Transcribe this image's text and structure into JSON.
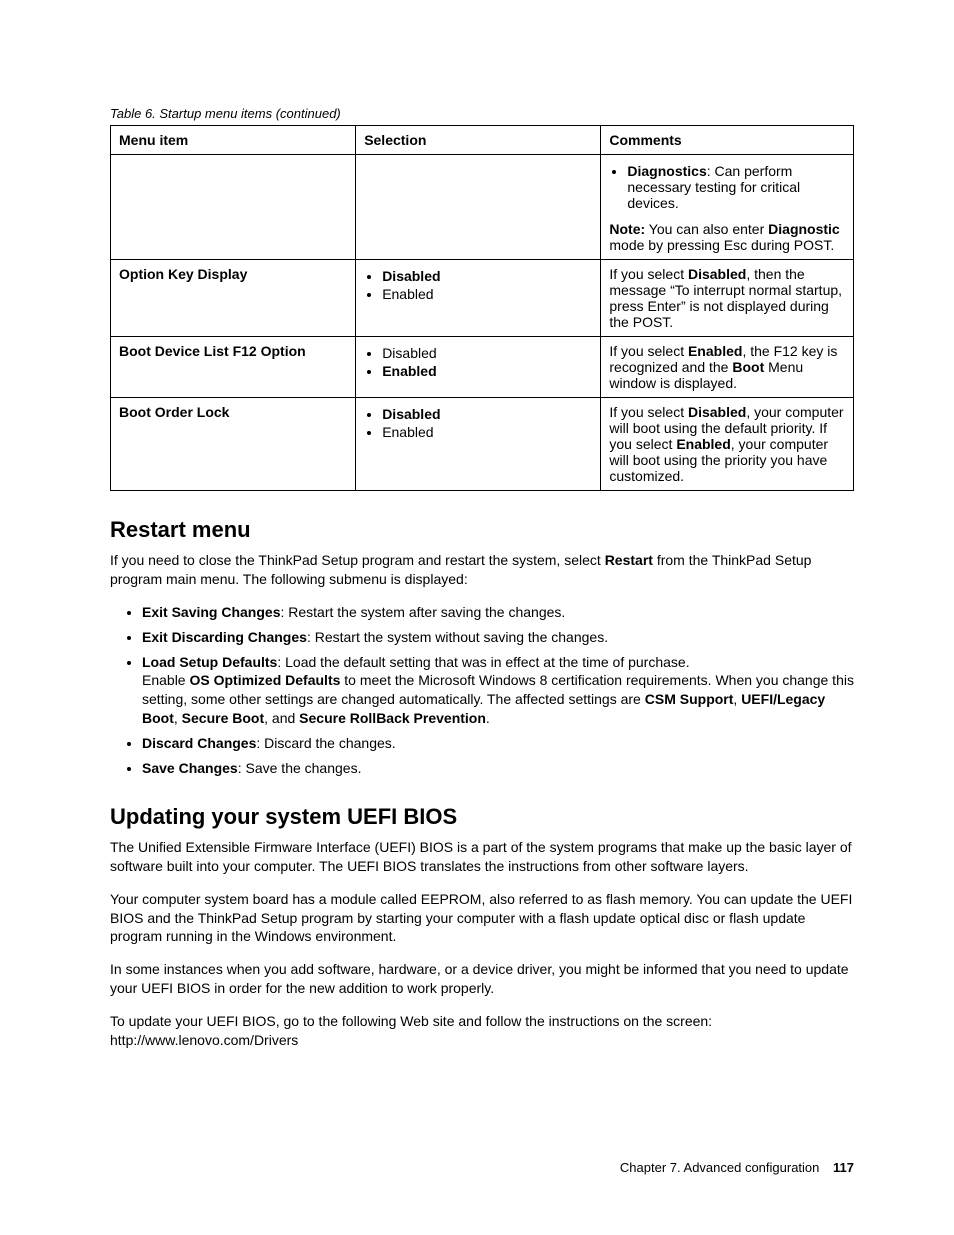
{
  "tableCaption": "Table 6.  Startup menu items (continued)",
  "headers": {
    "menu": "Menu item",
    "selection": "Selection",
    "comments": "Comments"
  },
  "row0": {
    "diagLabel": "Diagnostics",
    "diagText": ": Can perform necessary testing for critical devices.",
    "notePrefix": "Note:",
    "noteMid": " You can also enter ",
    "noteBold": "Diagnostic",
    "noteEnd": " mode by pressing Esc during POST."
  },
  "row1": {
    "menu": "Option Key Display",
    "sel1": "Disabled",
    "sel2": "Enabled",
    "c1": "If you select ",
    "cBold": "Disabled",
    "c2": ", then the message “To interrupt normal startup, press Enter” is not displayed during the POST."
  },
  "row2": {
    "menu": "Boot Device List F12 Option",
    "sel1": "Disabled",
    "sel2": "Enabled",
    "c1": "If you select ",
    "cBold1": "Enabled",
    "c2": ", the F12 key is recognized and the ",
    "cBold2": "Boot",
    "c3": " Menu window is displayed."
  },
  "row3": {
    "menu": "Boot Order Lock",
    "sel1": "Disabled",
    "sel2": "Enabled",
    "c1": "If you select ",
    "cBold1": "Disabled",
    "c2": ", your computer will boot using the default priority. If you select ",
    "cBold2": "Enabled",
    "c3": ", your computer will boot using the priority you have customized."
  },
  "restart": {
    "heading": "Restart menu",
    "intro1": "If you need to close the ThinkPad Setup program and restart the system, select ",
    "introBold": "Restart",
    "intro2": " from the ThinkPad Setup program main menu.  The following submenu is displayed:",
    "li1b": "Exit Saving Changes",
    "li1t": ": Restart the system after saving the changes.",
    "li2b": "Exit Discarding Changes",
    "li2t": ": Restart the system without saving the changes.",
    "li3b": "Load Setup Defaults",
    "li3t1": ": Load the default setting that was in effect at the time of purchase.",
    "li3t2a": "Enable ",
    "li3t2b": "OS Optimized Defaults",
    "li3t2c": " to meet the Microsoft Windows 8 certification requirements.  When you change this setting, some other settings are changed automatically.  The affected settings are ",
    "li3csm": "CSM Support",
    "li3sep1": ", ",
    "li3uefi": "UEFI/Legacy Boot",
    "li3sep2": ", ",
    "li3sb": "Secure Boot",
    "li3sep3": ", and ",
    "li3srp": "Secure RollBack Prevention",
    "li3end": ".",
    "li4b": "Discard Changes",
    "li4t": ": Discard the changes.",
    "li5b": "Save Changes",
    "li5t": ": Save the changes."
  },
  "uefi": {
    "heading": "Updating your system UEFI BIOS",
    "p1": "The Unified Extensible Firmware Interface (UEFI) BIOS is a part of the system programs that make up the basic layer of software built into your computer.  The UEFI BIOS translates the instructions from other software layers.",
    "p2": "Your computer system board has a module called EEPROM, also referred to as flash memory.  You can update the UEFI BIOS and the ThinkPad Setup program by starting your computer with a flash update optical disc or flash update program running in the Windows environment.",
    "p3": "In some instances when you add software, hardware, or a device driver, you might be informed that you need to update your UEFI BIOS in order for the new addition to work properly.",
    "p4a": "To update your UEFI BIOS, go to the following Web site and follow the instructions on the screen:",
    "p4b": "http://www.lenovo.com/Drivers"
  },
  "footer": {
    "chapter": "Chapter 7.  Advanced configuration",
    "page": "117"
  }
}
